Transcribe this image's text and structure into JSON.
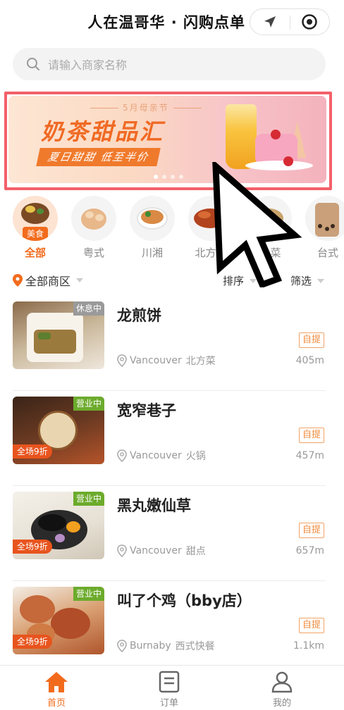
{
  "header": {
    "title": "人在温哥华 · 闪购点单",
    "nav_icon": "location-arrow-icon",
    "record_icon": "target-icon"
  },
  "search": {
    "placeholder": "请输入商家名称",
    "icon": "search-icon"
  },
  "banner": {
    "subtitle": "5月母亲节",
    "title": "奶茶甜品汇",
    "tag": "夏日甜甜 低至半价",
    "slides": 4,
    "active_slide": 0
  },
  "categories": [
    {
      "label": "全部",
      "badge": "美食",
      "active": true
    },
    {
      "label": "粤式",
      "active": false
    },
    {
      "label": "川湘",
      "active": false
    },
    {
      "label": "北方菜",
      "active": false
    },
    {
      "label": "菜",
      "active": false
    },
    {
      "label": "台式",
      "active": false
    }
  ],
  "filters": {
    "zone": "全部商区",
    "sort": "排序",
    "filter": "筛选"
  },
  "shops": [
    {
      "name": "龙煎饼",
      "status": "休息中",
      "status_type": "closed",
      "discount": "",
      "pickup": "自提",
      "city": "Vancouver",
      "cuisine": "北方菜",
      "distance": "405m"
    },
    {
      "name": "宽窄巷子",
      "status": "营业中",
      "status_type": "open",
      "discount": "全场9折",
      "pickup": "自提",
      "city": "Vancouver",
      "cuisine": "火锅",
      "distance": "457m"
    },
    {
      "name": "黑丸嫩仙草",
      "status": "营业中",
      "status_type": "open",
      "discount": "全场9折",
      "pickup": "自提",
      "city": "Vancouver",
      "cuisine": "甜点",
      "distance": "657m"
    },
    {
      "name": "叫了个鸡（bby店）",
      "status": "营业中",
      "status_type": "open",
      "discount": "全场9折",
      "pickup": "自提",
      "city": "Burnaby",
      "cuisine": "西式快餐",
      "distance": "1.1km"
    }
  ],
  "tabbar": {
    "tabs": [
      {
        "label": "首页",
        "icon": "home-icon",
        "active": true
      },
      {
        "label": "订单",
        "icon": "orders-icon",
        "active": false
      },
      {
        "label": "我的",
        "icon": "profile-icon",
        "active": false
      }
    ]
  },
  "colors": {
    "accent": "#f26b1d",
    "open": "#6cab2c",
    "closed": "#9a9a9a",
    "highlight_frame": "#f4606a"
  }
}
